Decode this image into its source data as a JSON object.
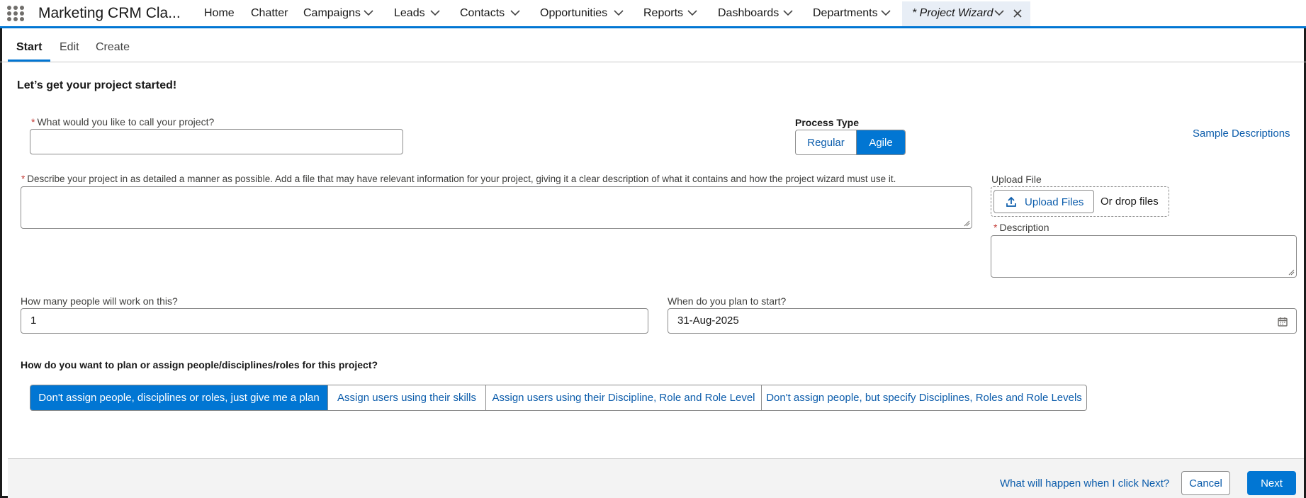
{
  "app": {
    "name": "Marketing CRM Cla...",
    "waffle_icon": "app-launcher-icon"
  },
  "nav": {
    "items": [
      {
        "label": "Home",
        "has_menu": false
      },
      {
        "label": "Chatter",
        "has_menu": false
      },
      {
        "label": "Campaigns",
        "has_menu": true
      },
      {
        "label": "Leads",
        "has_menu": true
      },
      {
        "label": "Contacts",
        "has_menu": true
      },
      {
        "label": "Opportunities",
        "has_menu": true
      },
      {
        "label": "Reports",
        "has_menu": true
      },
      {
        "label": "Dashboards",
        "has_menu": true
      },
      {
        "label": "Departments",
        "has_menu": true
      }
    ],
    "active_tab": "* Project Wizard"
  },
  "subtabs": [
    "Start",
    "Edit",
    "Create"
  ],
  "form": {
    "heading": "Let’s get your project started!",
    "required_marker": "*",
    "project_name_label": "What would you like to call your project?",
    "project_name_value": "",
    "process_type_label": "Process Type",
    "process_types": [
      "Regular",
      "Agile"
    ],
    "process_type_selected": "Agile",
    "sample_descriptions_link": "Sample Descriptions",
    "describe_label": "Describe your project in as detailed a manner as possible. Add a file that may have relevant information for your project, giving it a clear description of what it contains and how the project wizard must use it.",
    "describe_value": "",
    "upload_label": "Upload File",
    "upload_button": "Upload Files",
    "drop_text": "Or drop files",
    "description_label": "Description",
    "people_label": "How many people will work on this?",
    "people_value": "1",
    "start_label": "When do you plan to start?",
    "start_value": "31-Aug-2025",
    "assign_question": "How do you want to plan or assign people/disciplines/roles for this project?",
    "assign_options": [
      "Don't assign people, disciplines or roles, just give me a plan",
      "Assign users using their skills",
      "Assign users using their Discipline, Role and Role Level",
      "Don't assign people, but specify Disciplines, Roles and Role Levels"
    ],
    "assign_selected_index": 0
  },
  "footer": {
    "help_link": "What will happen when I click Next?",
    "cancel": "Cancel",
    "next": "Next"
  },
  "colors": {
    "brand": "#0176d3",
    "link": "#0b5cab",
    "required": "#c23934",
    "active_tab_bg": "#e8eef6"
  }
}
